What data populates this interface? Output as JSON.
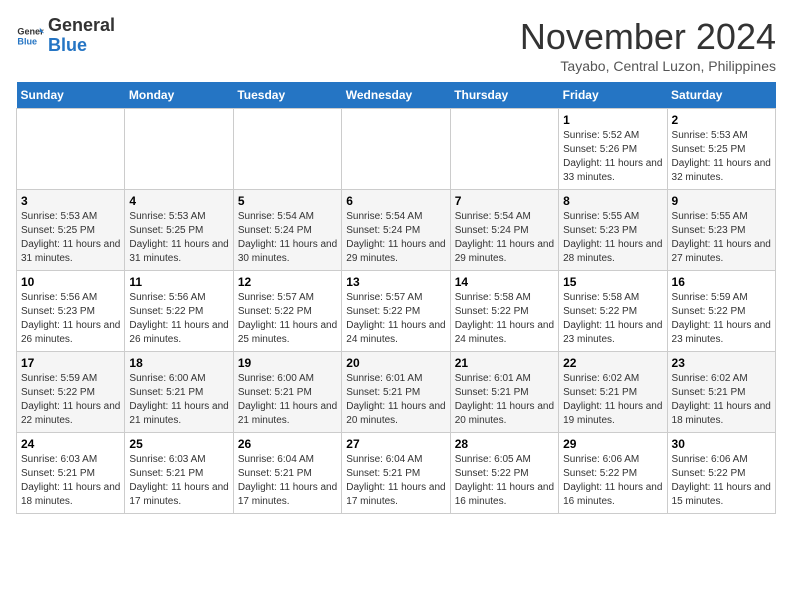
{
  "header": {
    "logo_general": "General",
    "logo_blue": "Blue",
    "month_title": "November 2024",
    "subtitle": "Tayabo, Central Luzon, Philippines"
  },
  "weekdays": [
    "Sunday",
    "Monday",
    "Tuesday",
    "Wednesday",
    "Thursday",
    "Friday",
    "Saturday"
  ],
  "weeks": [
    [
      {
        "day": "",
        "info": ""
      },
      {
        "day": "",
        "info": ""
      },
      {
        "day": "",
        "info": ""
      },
      {
        "day": "",
        "info": ""
      },
      {
        "day": "",
        "info": ""
      },
      {
        "day": "1",
        "info": "Sunrise: 5:52 AM\nSunset: 5:26 PM\nDaylight: 11 hours and 33 minutes."
      },
      {
        "day": "2",
        "info": "Sunrise: 5:53 AM\nSunset: 5:25 PM\nDaylight: 11 hours and 32 minutes."
      }
    ],
    [
      {
        "day": "3",
        "info": "Sunrise: 5:53 AM\nSunset: 5:25 PM\nDaylight: 11 hours and 31 minutes."
      },
      {
        "day": "4",
        "info": "Sunrise: 5:53 AM\nSunset: 5:25 PM\nDaylight: 11 hours and 31 minutes."
      },
      {
        "day": "5",
        "info": "Sunrise: 5:54 AM\nSunset: 5:24 PM\nDaylight: 11 hours and 30 minutes."
      },
      {
        "day": "6",
        "info": "Sunrise: 5:54 AM\nSunset: 5:24 PM\nDaylight: 11 hours and 29 minutes."
      },
      {
        "day": "7",
        "info": "Sunrise: 5:54 AM\nSunset: 5:24 PM\nDaylight: 11 hours and 29 minutes."
      },
      {
        "day": "8",
        "info": "Sunrise: 5:55 AM\nSunset: 5:23 PM\nDaylight: 11 hours and 28 minutes."
      },
      {
        "day": "9",
        "info": "Sunrise: 5:55 AM\nSunset: 5:23 PM\nDaylight: 11 hours and 27 minutes."
      }
    ],
    [
      {
        "day": "10",
        "info": "Sunrise: 5:56 AM\nSunset: 5:23 PM\nDaylight: 11 hours and 26 minutes."
      },
      {
        "day": "11",
        "info": "Sunrise: 5:56 AM\nSunset: 5:22 PM\nDaylight: 11 hours and 26 minutes."
      },
      {
        "day": "12",
        "info": "Sunrise: 5:57 AM\nSunset: 5:22 PM\nDaylight: 11 hours and 25 minutes."
      },
      {
        "day": "13",
        "info": "Sunrise: 5:57 AM\nSunset: 5:22 PM\nDaylight: 11 hours and 24 minutes."
      },
      {
        "day": "14",
        "info": "Sunrise: 5:58 AM\nSunset: 5:22 PM\nDaylight: 11 hours and 24 minutes."
      },
      {
        "day": "15",
        "info": "Sunrise: 5:58 AM\nSunset: 5:22 PM\nDaylight: 11 hours and 23 minutes."
      },
      {
        "day": "16",
        "info": "Sunrise: 5:59 AM\nSunset: 5:22 PM\nDaylight: 11 hours and 23 minutes."
      }
    ],
    [
      {
        "day": "17",
        "info": "Sunrise: 5:59 AM\nSunset: 5:22 PM\nDaylight: 11 hours and 22 minutes."
      },
      {
        "day": "18",
        "info": "Sunrise: 6:00 AM\nSunset: 5:21 PM\nDaylight: 11 hours and 21 minutes."
      },
      {
        "day": "19",
        "info": "Sunrise: 6:00 AM\nSunset: 5:21 PM\nDaylight: 11 hours and 21 minutes."
      },
      {
        "day": "20",
        "info": "Sunrise: 6:01 AM\nSunset: 5:21 PM\nDaylight: 11 hours and 20 minutes."
      },
      {
        "day": "21",
        "info": "Sunrise: 6:01 AM\nSunset: 5:21 PM\nDaylight: 11 hours and 20 minutes."
      },
      {
        "day": "22",
        "info": "Sunrise: 6:02 AM\nSunset: 5:21 PM\nDaylight: 11 hours and 19 minutes."
      },
      {
        "day": "23",
        "info": "Sunrise: 6:02 AM\nSunset: 5:21 PM\nDaylight: 11 hours and 18 minutes."
      }
    ],
    [
      {
        "day": "24",
        "info": "Sunrise: 6:03 AM\nSunset: 5:21 PM\nDaylight: 11 hours and 18 minutes."
      },
      {
        "day": "25",
        "info": "Sunrise: 6:03 AM\nSunset: 5:21 PM\nDaylight: 11 hours and 17 minutes."
      },
      {
        "day": "26",
        "info": "Sunrise: 6:04 AM\nSunset: 5:21 PM\nDaylight: 11 hours and 17 minutes."
      },
      {
        "day": "27",
        "info": "Sunrise: 6:04 AM\nSunset: 5:21 PM\nDaylight: 11 hours and 17 minutes."
      },
      {
        "day": "28",
        "info": "Sunrise: 6:05 AM\nSunset: 5:22 PM\nDaylight: 11 hours and 16 minutes."
      },
      {
        "day": "29",
        "info": "Sunrise: 6:06 AM\nSunset: 5:22 PM\nDaylight: 11 hours and 16 minutes."
      },
      {
        "day": "30",
        "info": "Sunrise: 6:06 AM\nSunset: 5:22 PM\nDaylight: 11 hours and 15 minutes."
      }
    ]
  ]
}
